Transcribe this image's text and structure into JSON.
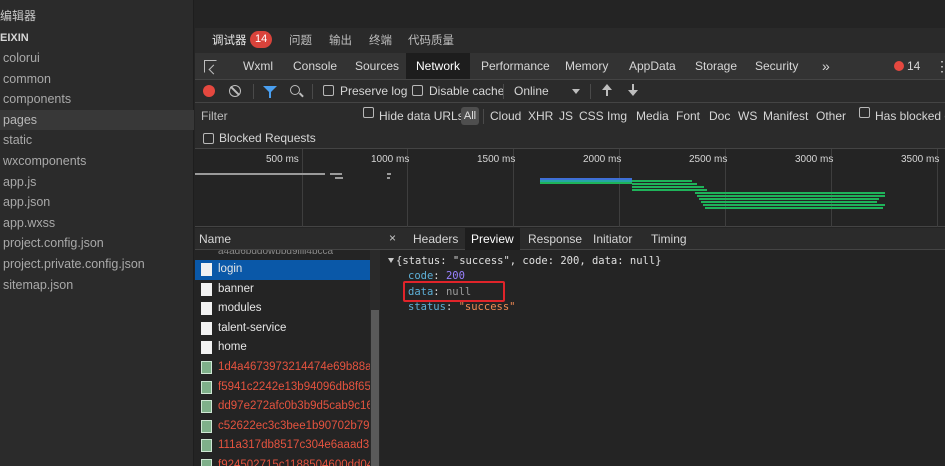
{
  "explorer": {
    "title": "编辑器",
    "project_name": "EIXIN",
    "items": [
      {
        "label": "colorui"
      },
      {
        "label": "common"
      },
      {
        "label": "components"
      },
      {
        "label": "pages"
      },
      {
        "label": "static"
      },
      {
        "label": "wxcomponents"
      },
      {
        "label": "app.js"
      },
      {
        "label": "app.json"
      },
      {
        "label": "app.wxss"
      },
      {
        "label": "project.config.json"
      },
      {
        "label": "project.private.config.json"
      },
      {
        "label": "sitemap.json"
      }
    ],
    "selected": "pages"
  },
  "panel_tabs": {
    "debugger": "调试器",
    "badge": "14",
    "issues": "问题",
    "output": "输出",
    "terminal": "终端",
    "code_quality": "代码质量"
  },
  "devtools_tabs": [
    "Wxml",
    "Console",
    "Sources",
    "Network",
    "Performance",
    "Memory",
    "AppData",
    "Storage",
    "Security"
  ],
  "devtools_more": "»",
  "devtools_active": "Network",
  "error_count": "14",
  "kebab": "⋮",
  "network_toolbar": {
    "preserve_log": "Preserve log",
    "disable_cache": "Disable cache",
    "throttle": "Online"
  },
  "filter_row": {
    "placeholder": "Filter",
    "hide_data_urls": "Hide data URLs",
    "all": "All",
    "types": [
      "Cloud",
      "XHR",
      "JS",
      "CSS",
      "Img",
      "Media",
      "Font",
      "Doc",
      "WS",
      "Manifest",
      "Other"
    ],
    "has_blocked": "Has blocked c"
  },
  "blocked_requests": "Blocked Requests",
  "timeline": {
    "ticks": [
      "500 ms",
      "1000 ms",
      "1500 ms",
      "2000 ms",
      "2500 ms",
      "3000 ms",
      "3500 ms"
    ],
    "colors": {
      "green": "#1fb35a",
      "teal": "#26a6a6",
      "blue": "#3f6fd6",
      "grey": "#9a9a9a"
    }
  },
  "requests": {
    "header": "Name",
    "partial": "a4ad6bddowbbd9iiii4bcca",
    "rows": [
      {
        "name": "login",
        "kind": "doc",
        "state": "selected"
      },
      {
        "name": "banner",
        "kind": "doc",
        "state": "normal"
      },
      {
        "name": "modules",
        "kind": "doc",
        "state": "normal"
      },
      {
        "name": "talent-service",
        "kind": "doc",
        "state": "normal"
      },
      {
        "name": "home",
        "kind": "doc",
        "state": "normal"
      },
      {
        "name": "1d4a4673973214474e69b88a...",
        "kind": "img",
        "state": "error"
      },
      {
        "name": "f5941c2242e13b94096db8f65...",
        "kind": "img",
        "state": "error"
      },
      {
        "name": "dd97e272afc0b3b9d5cab9c16...",
        "kind": "img",
        "state": "error"
      },
      {
        "name": "c52622ec3c3bee1b90702b79b...",
        "kind": "img",
        "state": "error"
      },
      {
        "name": "111a317db8517c304e6aaad3...",
        "kind": "img",
        "state": "error"
      },
      {
        "name": "f924502715c1188504600dd04",
        "kind": "img",
        "state": "error"
      }
    ]
  },
  "detail_tabs": {
    "close": "×",
    "tabs": [
      "Headers",
      "Preview",
      "Response",
      "Initiator",
      "Timing"
    ],
    "active": "Preview"
  },
  "preview": {
    "summary": "{status: \"success\", code: 200, data: null}",
    "code_key": "code",
    "code_value": "200",
    "data_key": "data",
    "data_value": "null",
    "status_key": "status",
    "status_value": "\"success\""
  }
}
